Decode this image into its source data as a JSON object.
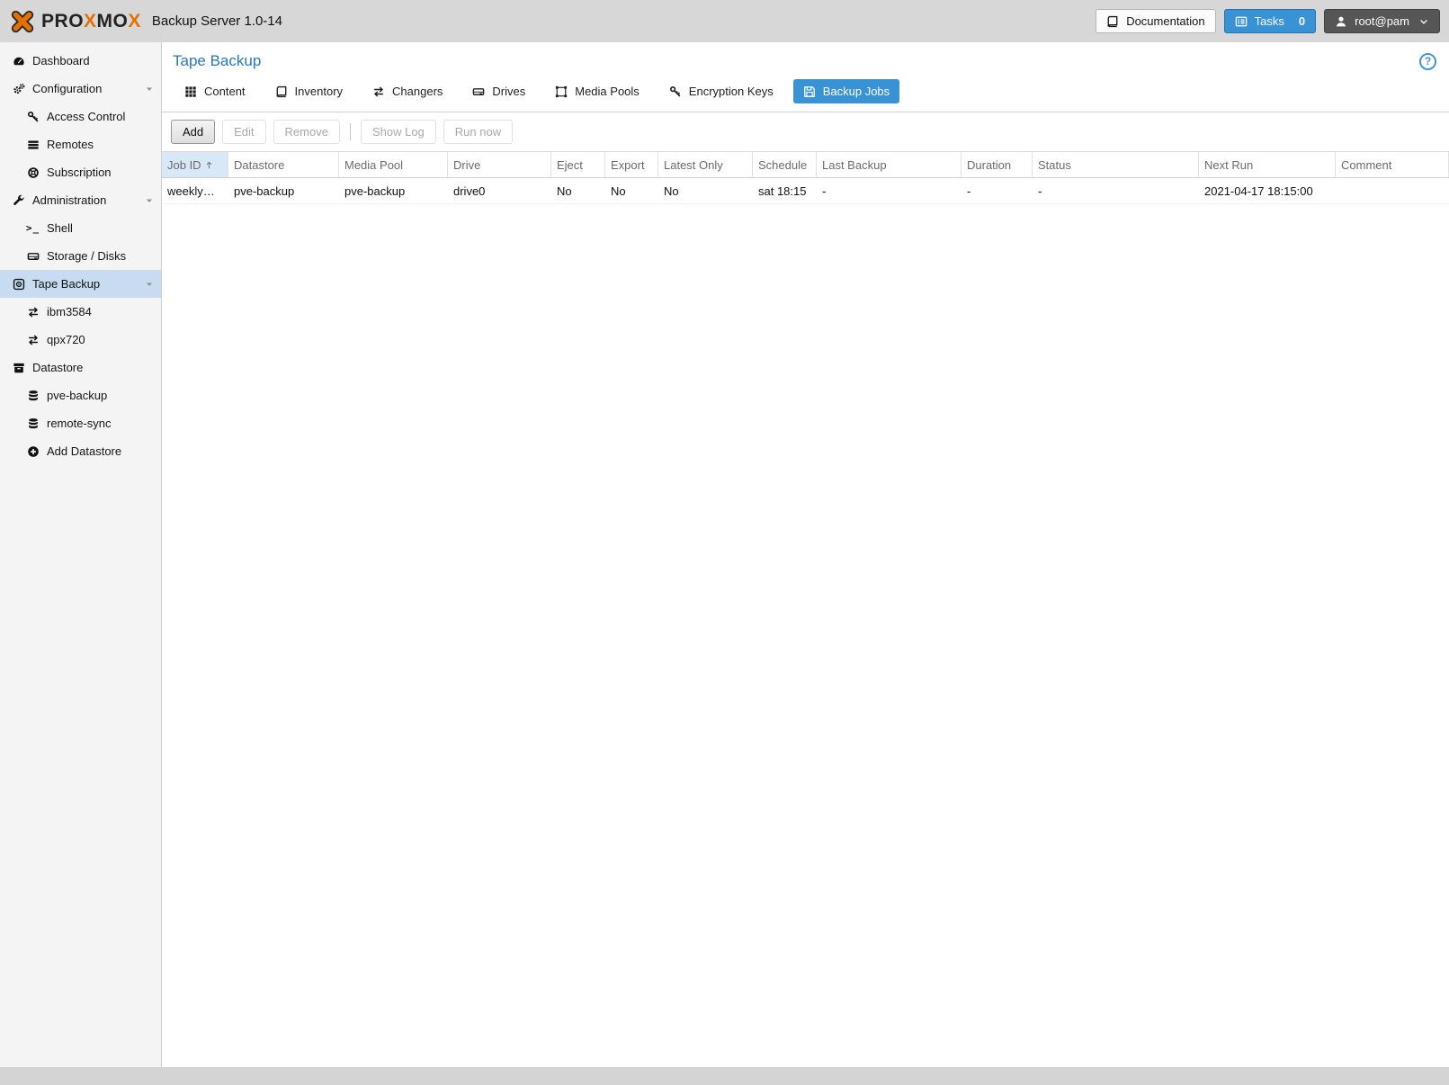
{
  "header": {
    "logo_text": "PROXMOX",
    "app_title": "Backup Server 1.0-14",
    "documentation_label": "Documentation",
    "tasks_label": "Tasks",
    "tasks_count": "0",
    "user_label": "root@pam"
  },
  "sidebar": {
    "items": [
      {
        "label": "Dashboard",
        "icon": "gauge-icon",
        "level": 0
      },
      {
        "label": "Configuration",
        "icon": "gears-icon",
        "level": 0,
        "expandable": true
      },
      {
        "label": "Access Control",
        "icon": "key-icon",
        "level": 1
      },
      {
        "label": "Remotes",
        "icon": "remotes-icon",
        "level": 1
      },
      {
        "label": "Subscription",
        "icon": "support-icon",
        "level": 1
      },
      {
        "label": "Administration",
        "icon": "wrench-icon",
        "level": 0,
        "expandable": true
      },
      {
        "label": "Shell",
        "icon": "terminal-icon",
        "level": 1
      },
      {
        "label": "Storage / Disks",
        "icon": "hdd-icon",
        "level": 1
      },
      {
        "label": "Tape Backup",
        "icon": "tape-icon",
        "level": 0,
        "expandable": true,
        "selected": true
      },
      {
        "label": "ibm3584",
        "icon": "exchange-icon",
        "level": 1
      },
      {
        "label": "qpx720",
        "icon": "exchange-icon",
        "level": 1
      },
      {
        "label": "Datastore",
        "icon": "archive-icon",
        "level": 0
      },
      {
        "label": "pve-backup",
        "icon": "database-icon",
        "level": 1
      },
      {
        "label": "remote-sync",
        "icon": "database-icon",
        "level": 1
      },
      {
        "label": "Add Datastore",
        "icon": "plus-circle-icon",
        "level": 1
      }
    ]
  },
  "content": {
    "title": "Tape Backup",
    "help_glyph": "?",
    "tabs": [
      {
        "label": "Content",
        "icon": "grid-icon"
      },
      {
        "label": "Inventory",
        "icon": "book-icon"
      },
      {
        "label": "Changers",
        "icon": "exchange-icon"
      },
      {
        "label": "Drives",
        "icon": "hdd-icon"
      },
      {
        "label": "Media Pools",
        "icon": "object-group-icon"
      },
      {
        "label": "Encryption Keys",
        "icon": "key-icon"
      },
      {
        "label": "Backup Jobs",
        "icon": "save-icon",
        "active": true
      }
    ],
    "toolbar": {
      "add": "Add",
      "edit": "Edit",
      "remove": "Remove",
      "show_log": "Show Log",
      "run_now": "Run now"
    },
    "table": {
      "columns": [
        {
          "label": "Job ID",
          "sorted": "asc"
        },
        {
          "label": "Datastore"
        },
        {
          "label": "Media Pool"
        },
        {
          "label": "Drive"
        },
        {
          "label": "Eject"
        },
        {
          "label": "Export"
        },
        {
          "label": "Latest Only"
        },
        {
          "label": "Schedule"
        },
        {
          "label": "Last Backup"
        },
        {
          "label": "Duration"
        },
        {
          "label": "Status"
        },
        {
          "label": "Next Run"
        },
        {
          "label": "Comment"
        }
      ],
      "rows": [
        [
          "weekly…",
          "pve-backup",
          "pve-backup",
          "drive0",
          "No",
          "No",
          "No",
          "sat 18:15",
          "-",
          "-",
          "-",
          "2021-04-17 18:15:00",
          ""
        ]
      ]
    }
  },
  "colors": {
    "accent_blue": "#3892d4",
    "brand_orange": "#E57000",
    "selected_item": "#c7dcf1",
    "sorted_column_bg": "#d9e8f6"
  }
}
